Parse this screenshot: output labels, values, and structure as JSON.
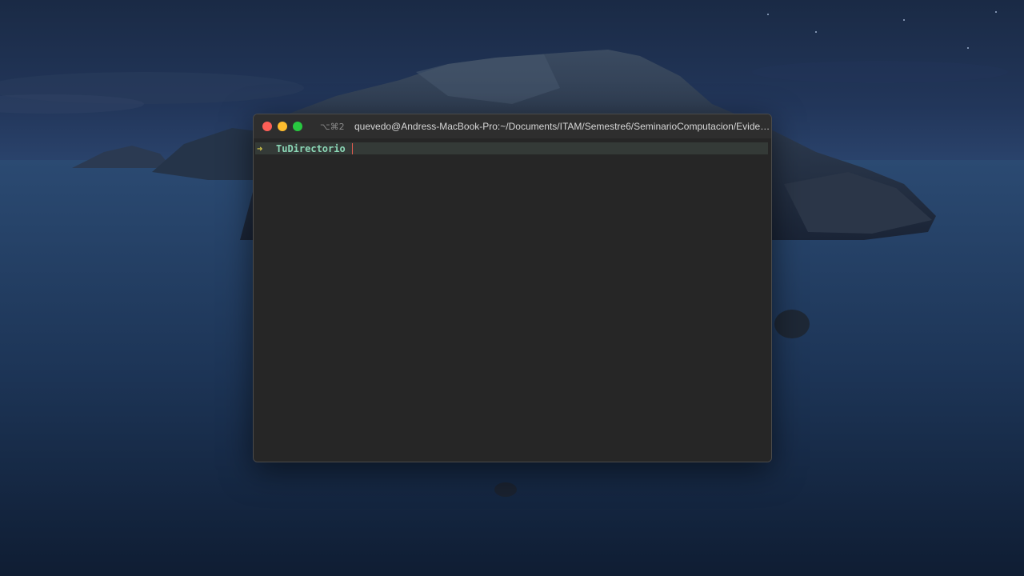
{
  "window": {
    "shortcut": "⌥⌘2",
    "title": "quevedo@Andress-MacBook-Pro:~/Documents/ITAM/Semestre6/SeminarioComputacion/Evidenci..."
  },
  "terminal": {
    "prompt_symbol": "➜",
    "directory": "TuDirectorio"
  },
  "colors": {
    "close": "#fe5f57",
    "minimize": "#febc2e",
    "maximize": "#28c840",
    "prompt_arrow": "#d4c64a",
    "directory": "#8bd7b6",
    "cursor": "#e05a4f"
  }
}
